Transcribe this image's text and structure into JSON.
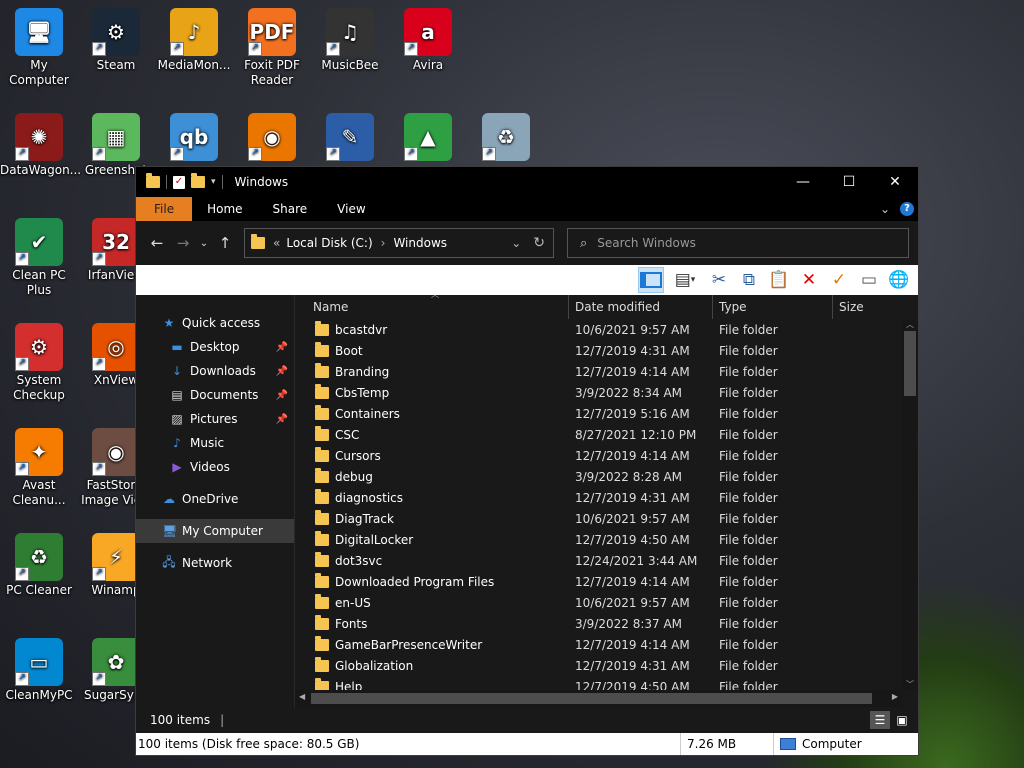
{
  "desktop": {
    "icons": [
      {
        "label": "My Computer",
        "icon": "computer-icon",
        "color": "#1e88e5"
      },
      {
        "label": "Steam",
        "icon": "steam-icon",
        "color": "#1b2838"
      },
      {
        "label": "MediaMon...",
        "icon": "mediamonkey-icon",
        "color": "#e8a317"
      },
      {
        "label": "Foxit PDF Reader",
        "icon": "foxit-icon",
        "color": "#f37021"
      },
      {
        "label": "MusicBee",
        "icon": "musicbee-icon",
        "color": "#333333"
      },
      {
        "label": "Avira",
        "icon": "avira-icon",
        "color": "#d9001b"
      },
      {
        "label": "DataWagon...",
        "icon": "datawagon-icon",
        "color": "#8b1a1a"
      },
      {
        "label": "Greenshot",
        "icon": "greenshot-icon",
        "color": "#5cb85c"
      },
      {
        "label": "",
        "icon": "qbittorrent-icon",
        "color": "#3d8fd6"
      },
      {
        "label": "",
        "icon": "blender-icon",
        "color": "#ea7600"
      },
      {
        "label": "",
        "icon": "settings-app-icon",
        "color": "#2c5ea8"
      },
      {
        "label": "",
        "icon": "avg-icon",
        "color": "#2ea043"
      },
      {
        "label": "",
        "icon": "recycle-bin-icon",
        "color": "#8aa4b8"
      },
      {
        "label": "Clean PC Plus",
        "icon": "cleanpc-icon",
        "color": "#1f8a4c"
      },
      {
        "label": "IrfanView",
        "icon": "irfanview-icon",
        "color": "#c62828"
      },
      {
        "label": "System Checkup",
        "icon": "system-checkup-icon",
        "color": "#d32f2f"
      },
      {
        "label": "XnView",
        "icon": "xnview-icon",
        "color": "#e65100"
      },
      {
        "label": "Avast Cleanu...",
        "icon": "avast-icon",
        "color": "#f57c00"
      },
      {
        "label": "FastStone Image View",
        "icon": "faststone-icon",
        "color": "#6d4c41"
      },
      {
        "label": "PC Cleaner",
        "icon": "pc-cleaner-icon",
        "color": "#2e7d32"
      },
      {
        "label": "Winamp",
        "icon": "winamp-icon",
        "color": "#f9a825"
      },
      {
        "label": "CleanMyPC",
        "icon": "cleanmypc-icon",
        "color": "#0288d1"
      },
      {
        "label": "SugarSync",
        "icon": "sugarsync-icon",
        "color": "#388e3c"
      }
    ]
  },
  "window": {
    "title": "Windows",
    "ribbon_tabs": [
      "File",
      "Home",
      "Share",
      "View"
    ],
    "address": {
      "prefix": "«",
      "segments": [
        "Local Disk (C:)",
        "Windows"
      ]
    },
    "search_placeholder": "Search Windows",
    "nav": {
      "quick_access": "Quick access",
      "items": [
        {
          "label": "Desktop",
          "icon": "desktop-icon",
          "pinned": true
        },
        {
          "label": "Downloads",
          "icon": "downloads-icon",
          "pinned": true
        },
        {
          "label": "Documents",
          "icon": "documents-icon",
          "pinned": true
        },
        {
          "label": "Pictures",
          "icon": "pictures-icon",
          "pinned": true
        },
        {
          "label": "Music",
          "icon": "music-icon",
          "pinned": false
        },
        {
          "label": "Videos",
          "icon": "videos-icon",
          "pinned": false
        }
      ],
      "onedrive": "OneDrive",
      "my_computer": "My Computer",
      "network": "Network"
    },
    "columns": {
      "name": "Name",
      "date": "Date modified",
      "type": "Type",
      "size": "Size"
    },
    "files": [
      {
        "name": "bcastdvr",
        "date": "10/6/2021 9:57 AM",
        "type": "File folder"
      },
      {
        "name": "Boot",
        "date": "12/7/2019 4:31 AM",
        "type": "File folder"
      },
      {
        "name": "Branding",
        "date": "12/7/2019 4:14 AM",
        "type": "File folder"
      },
      {
        "name": "CbsTemp",
        "date": "3/9/2022 8:34 AM",
        "type": "File folder"
      },
      {
        "name": "Containers",
        "date": "12/7/2019 5:16 AM",
        "type": "File folder"
      },
      {
        "name": "CSC",
        "date": "8/27/2021 12:10 PM",
        "type": "File folder"
      },
      {
        "name": "Cursors",
        "date": "12/7/2019 4:14 AM",
        "type": "File folder"
      },
      {
        "name": "debug",
        "date": "3/9/2022 8:28 AM",
        "type": "File folder"
      },
      {
        "name": "diagnostics",
        "date": "12/7/2019 4:31 AM",
        "type": "File folder"
      },
      {
        "name": "DiagTrack",
        "date": "10/6/2021 9:57 AM",
        "type": "File folder"
      },
      {
        "name": "DigitalLocker",
        "date": "12/7/2019 4:50 AM",
        "type": "File folder"
      },
      {
        "name": "dot3svc",
        "date": "12/24/2021 3:44 AM",
        "type": "File folder"
      },
      {
        "name": "Downloaded Program Files",
        "date": "12/7/2019 4:14 AM",
        "type": "File folder"
      },
      {
        "name": "en-US",
        "date": "10/6/2021 9:57 AM",
        "type": "File folder"
      },
      {
        "name": "Fonts",
        "date": "3/9/2022 8:37 AM",
        "type": "File folder"
      },
      {
        "name": "GameBarPresenceWriter",
        "date": "12/7/2019 4:14 AM",
        "type": "File folder"
      },
      {
        "name": "Globalization",
        "date": "12/7/2019 4:31 AM",
        "type": "File folder"
      },
      {
        "name": "Help",
        "date": "12/7/2019 4:50 AM",
        "type": "File folder"
      }
    ],
    "status_items": "100 items",
    "status_bar": {
      "summary": "100 items (Disk free space: 80.5 GB)",
      "size": "7.26 MB",
      "location": "Computer"
    }
  }
}
